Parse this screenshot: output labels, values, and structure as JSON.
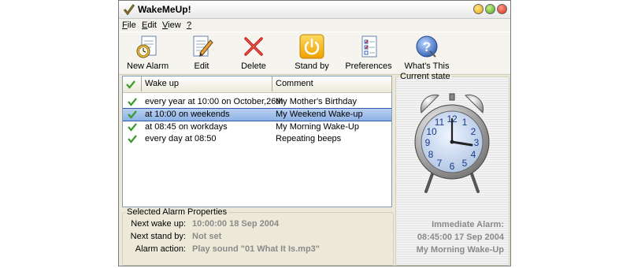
{
  "window": {
    "title": "WakeMeUp!"
  },
  "menu": [
    {
      "label": "File",
      "underline": "F",
      "rest": "ile"
    },
    {
      "label": "Edit",
      "underline": "E",
      "rest": "dit"
    },
    {
      "label": "View",
      "underline": "V",
      "rest": "iew"
    },
    {
      "label": "?",
      "underline": "?",
      "rest": ""
    }
  ],
  "toolbar": [
    {
      "label": "New Alarm",
      "icon": "new-alarm-icon"
    },
    {
      "label": "Edit",
      "icon": "edit-pencil-icon"
    },
    {
      "label": "Delete",
      "icon": "delete-x-icon"
    },
    {
      "label": "Stand by",
      "icon": "power-icon"
    },
    {
      "label": "Preferences",
      "icon": "preferences-icon"
    },
    {
      "label": "What's This",
      "icon": "help-icon"
    }
  ],
  "list": {
    "columns": [
      "Wake up",
      "Comment"
    ],
    "rows": [
      {
        "wake": "every year at 10:00 on October,26th",
        "comment": "My Mother's Birthday",
        "selected": false
      },
      {
        "wake": "at 10:00 on weekends",
        "comment": "My Weekend Wake-up",
        "selected": true
      },
      {
        "wake": "at 08:45 on workdays",
        "comment": "My Morning Wake-Up",
        "selected": false
      },
      {
        "wake": "every day at 08:50",
        "comment": "Repeating beeps",
        "selected": false
      }
    ]
  },
  "properties": {
    "title": "Selected Alarm Properties",
    "next_wake_label": "Next wake up:",
    "next_wake_value": "10:00:00 18 Sep 2004",
    "next_standby_label": "Next stand by:",
    "next_standby_value": "Not set",
    "action_label": "Alarm action:",
    "action_value": "Play sound \"01 What It Is.mp3\""
  },
  "state": {
    "title": "Current state",
    "line1": "Immediate Alarm:",
    "line2": "08:45:00 17 Sep 2004",
    "line3": "My Morning Wake-Up",
    "clock_numbers": [
      "12",
      "1",
      "2",
      "3",
      "4",
      "5",
      "6",
      "7",
      "8",
      "9",
      "10",
      "11"
    ]
  },
  "colors": {
    "check": "#3a9a2a",
    "selection": "#8eb2e6",
    "accent_blue": "#2f5fb5"
  }
}
